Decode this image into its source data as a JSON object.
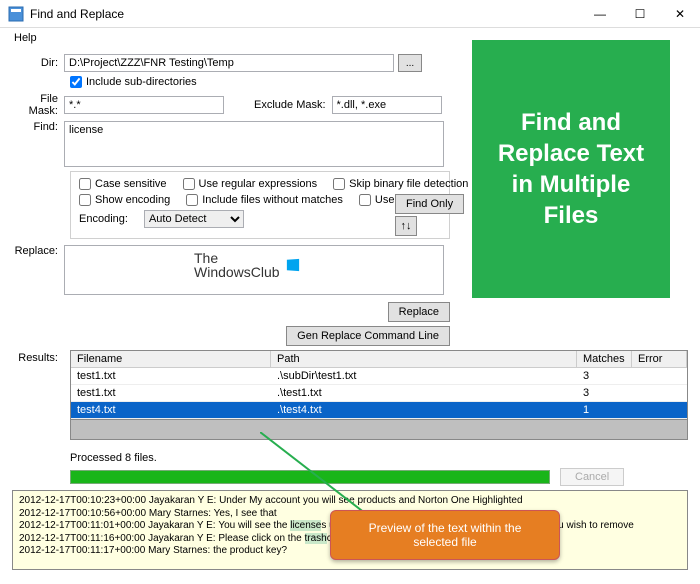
{
  "window": {
    "title": "Find and Replace"
  },
  "menu": {
    "help": "Help"
  },
  "labels": {
    "dir": "Dir:",
    "include_subdirs": "Include sub-directories",
    "file_mask": "File Mask:",
    "exclude_mask": "Exclude Mask:",
    "find": "Find:",
    "replace": "Replace:",
    "results": "Results:",
    "case_sensitive": "Case sensitive",
    "use_regex": "Use regular expressions",
    "skip_binary": "Skip binary file detection",
    "show_encoding": "Show encoding",
    "include_no_match": "Include files without matches",
    "use_escape": "Use escape chars",
    "encoding": "Encoding:"
  },
  "values": {
    "dir": "D:\\Project\\ZZZ\\FNR Testing\\Temp",
    "include_subdirs_checked": true,
    "file_mask": "*.*",
    "exclude_mask": "*.dll, *.exe",
    "find": "license",
    "encoding": "Auto Detect"
  },
  "buttons": {
    "browse": "...",
    "find_only": "Find Only",
    "swap": "↑↓",
    "replace": "Replace",
    "gen_cmd": "Gen Replace Command Line",
    "cancel": "Cancel"
  },
  "logo": {
    "line1": "The",
    "line2": "WindowsClub"
  },
  "results": {
    "columns": {
      "filename": "Filename",
      "path": "Path",
      "matches": "Matches",
      "error": "Error"
    },
    "rows": [
      {
        "filename": "test1.txt",
        "path": ".\\subDir\\test1.txt",
        "matches": "3",
        "error": ""
      },
      {
        "filename": "test1.txt",
        "path": ".\\test1.txt",
        "matches": "3",
        "error": ""
      },
      {
        "filename": "test4.txt",
        "path": ".\\test4.txt",
        "matches": "1",
        "error": "",
        "selected": true
      }
    ]
  },
  "progress": {
    "status": "Processed 8 files."
  },
  "preview": {
    "lines": [
      "2012-12-17T00:10:23+00:00 Jayakaran Y E: <span dir=\"ltr\">Under My account you will see products and Norton One Highlighted</span>",
      "2012-12-17T00:10:56+00:00 Mary Starnes: Yes, I see that",
      "2012-12-17T00:11:01+00:00 Jayakaran Y E: <span dir=\"ltr\">You will see the licenses used.  You will find the name of the computer that you wish to remove</span>",
      "2012-12-17T00:11:16+00:00 Jayakaran Y E: <span dir=\"ltr\">Please click on the trashcan next to it and remove it</span>",
      "2012-12-17T00:11:17+00:00 Mary Starnes: the product key?"
    ]
  },
  "banner": {
    "text": "Find and Replace Text in Multiple Files"
  },
  "callout": {
    "text": "Preview of the text within the selected file"
  }
}
